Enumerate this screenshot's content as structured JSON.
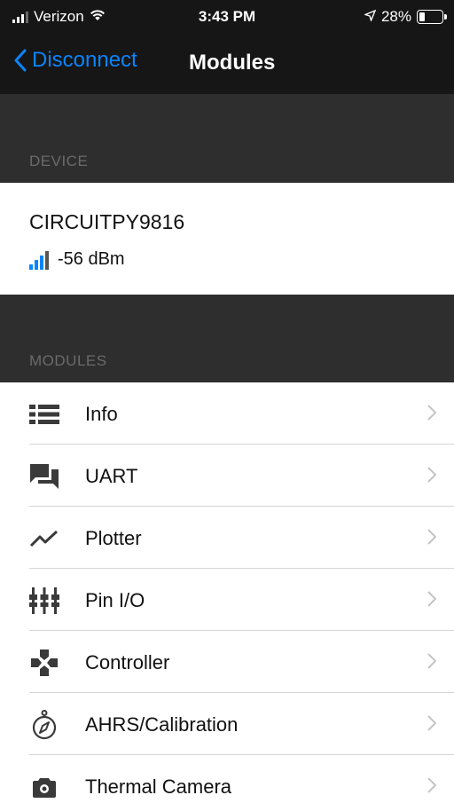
{
  "status_bar": {
    "carrier": "Verizon",
    "time": "3:43 PM",
    "battery_percent": "28%",
    "battery_level": 0.28,
    "icons": [
      "cellular-signal-icon",
      "wifi-icon",
      "location-arrow-icon",
      "battery-icon"
    ]
  },
  "nav": {
    "back_label": "Disconnect",
    "title": "Modules",
    "accent_color": "#0a84ff"
  },
  "sections": {
    "device_header": "DEVICE",
    "modules_header": "MODULES"
  },
  "device": {
    "name": "CIRCUITPY9816",
    "rssi": "-56 dBm",
    "signal_bars_active": 3,
    "signal_bars_total": 4,
    "signal_color_active": "#0a84ff",
    "signal_color_inactive": "#555555"
  },
  "modules": [
    {
      "label": "Info",
      "icon": "list-icon"
    },
    {
      "label": "UART",
      "icon": "chat-bubbles-icon"
    },
    {
      "label": "Plotter",
      "icon": "line-graph-icon"
    },
    {
      "label": "Pin I/O",
      "icon": "pins-icon"
    },
    {
      "label": "Controller",
      "icon": "gamepad-icon"
    },
    {
      "label": "AHRS/Calibration",
      "icon": "compass-icon"
    },
    {
      "label": "Thermal Camera",
      "icon": "camera-icon"
    }
  ]
}
